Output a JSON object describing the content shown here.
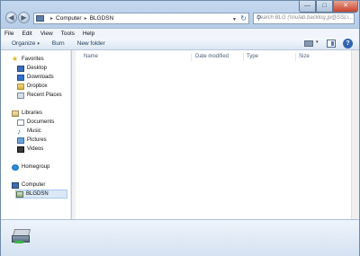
{
  "address": {
    "crumbs": [
      "Computer",
      "BLGDSN"
    ]
  },
  "search": {
    "placeholder": "Search BLG (\\\\nulab.backlog.jp@SSL\\..."
  },
  "menu": [
    "File",
    "Edit",
    "View",
    "Tools",
    "Help"
  ],
  "toolbar": {
    "organize": "Organize",
    "burn": "Burn",
    "new_folder": "New folder"
  },
  "nav": {
    "favorites": "Favorites",
    "desktop": "Desktop",
    "downloads": "Downloads",
    "dropbox": "Dropbox",
    "recent": "Recent Places",
    "libraries": "Libraries",
    "documents": "Documents",
    "music": "Music",
    "pictures": "Pictures",
    "videos": "Videos",
    "homegroup": "Homegroup",
    "computer": "Computer",
    "blgdsn": "BLGDSN"
  },
  "columns": {
    "name": "Name",
    "date": "Date modified",
    "type": "Type",
    "size": "Size"
  },
  "icons": [
    "back-icon",
    "forward-icon",
    "computer-icon",
    "refresh-icon",
    "search-icon",
    "minimize-icon",
    "maximize-icon",
    "close-icon",
    "view-icon",
    "preview-pane-icon",
    "help-icon",
    "star-icon",
    "folder-icon",
    "drive-icon"
  ]
}
